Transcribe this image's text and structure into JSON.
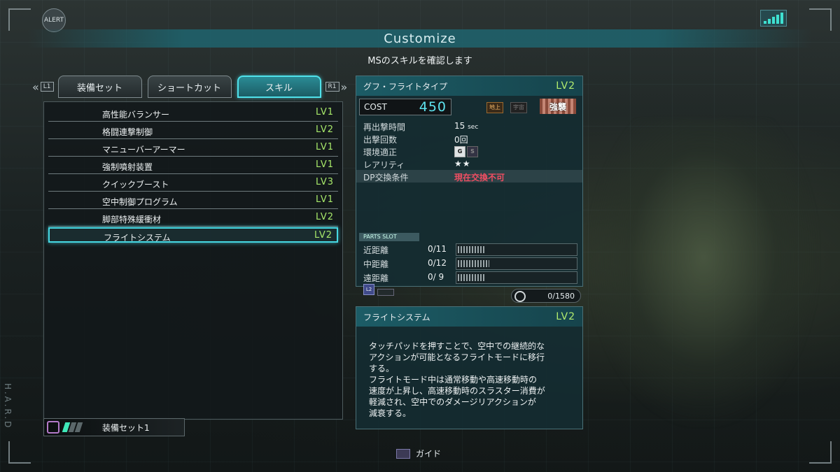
{
  "header": {
    "alert_label": "ALERT",
    "title": "Customize",
    "subtitle": "MSのスキルを確認します"
  },
  "side_text": "H.A.R.D",
  "tabs": {
    "left_key": "L1",
    "right_key": "R1",
    "items": [
      {
        "label": "装備セット"
      },
      {
        "label": "ショートカット"
      },
      {
        "label": "スキル",
        "active": true
      }
    ]
  },
  "skills": [
    {
      "name": "高性能バランサー",
      "level": "LV1"
    },
    {
      "name": "格闘連撃制御",
      "level": "LV2"
    },
    {
      "name": "マニューバーアーマー",
      "level": "LV1"
    },
    {
      "name": "強制噴射装置",
      "level": "LV1"
    },
    {
      "name": "クイックブースト",
      "level": "LV3"
    },
    {
      "name": "空中制御プログラム",
      "level": "LV1"
    },
    {
      "name": "脚部特殊緩衝材",
      "level": "LV2"
    },
    {
      "name": "フライトシステム",
      "level": "LV2",
      "selected": true
    }
  ],
  "loadout": {
    "label": "装備セット1",
    "filled_bars": 1,
    "total_bars": 3
  },
  "ms": {
    "name": "グフ・フライトタイプ",
    "level": "LV2",
    "cost_label": "COST",
    "cost_value": "450",
    "env_ground": "地上",
    "env_space": "宇宙",
    "enhance_label": "強襲",
    "stats": [
      {
        "key": "再出撃時間",
        "value": "15",
        "unit": "sec"
      },
      {
        "key": "出撃回数",
        "value": "0回"
      },
      {
        "key": "環境適正",
        "value": ""
      },
      {
        "key": "レアリティ",
        "value": "★★"
      },
      {
        "key": "DP交換条件",
        "value": "現在交換不可"
      }
    ],
    "env_icons": {
      "ground": "G",
      "space": "S"
    }
  },
  "parts_slot": {
    "label": "PARTS SLOT",
    "rows": [
      {
        "key": "近距離",
        "value": "0/11",
        "fill": 0.23
      },
      {
        "key": "中距離",
        "value": "0/12",
        "fill": 0.27
      },
      {
        "key": "遠距離",
        "value": "0/ 9",
        "fill": 0.24
      }
    ],
    "l2_key": "L2",
    "capacity": "0/1580"
  },
  "skill_detail": {
    "name": "フライトシステム",
    "level": "LV2",
    "description": "タッチパッドを押すことで、空中での継続的な\nアクションが可能となるフライトモードに移行\nする。\nフライトモード中は通常移動や高速移動時の\n速度が上昇し、高速移動時のスラスター消費が\n軽減され、空中でのダメージリアクションが\n減衰する。"
  },
  "footer": {
    "guide_label": "ガイド"
  },
  "colors": {
    "accent": "#46d8e3",
    "level": "#a7e86a",
    "warning": "#f04e62"
  }
}
